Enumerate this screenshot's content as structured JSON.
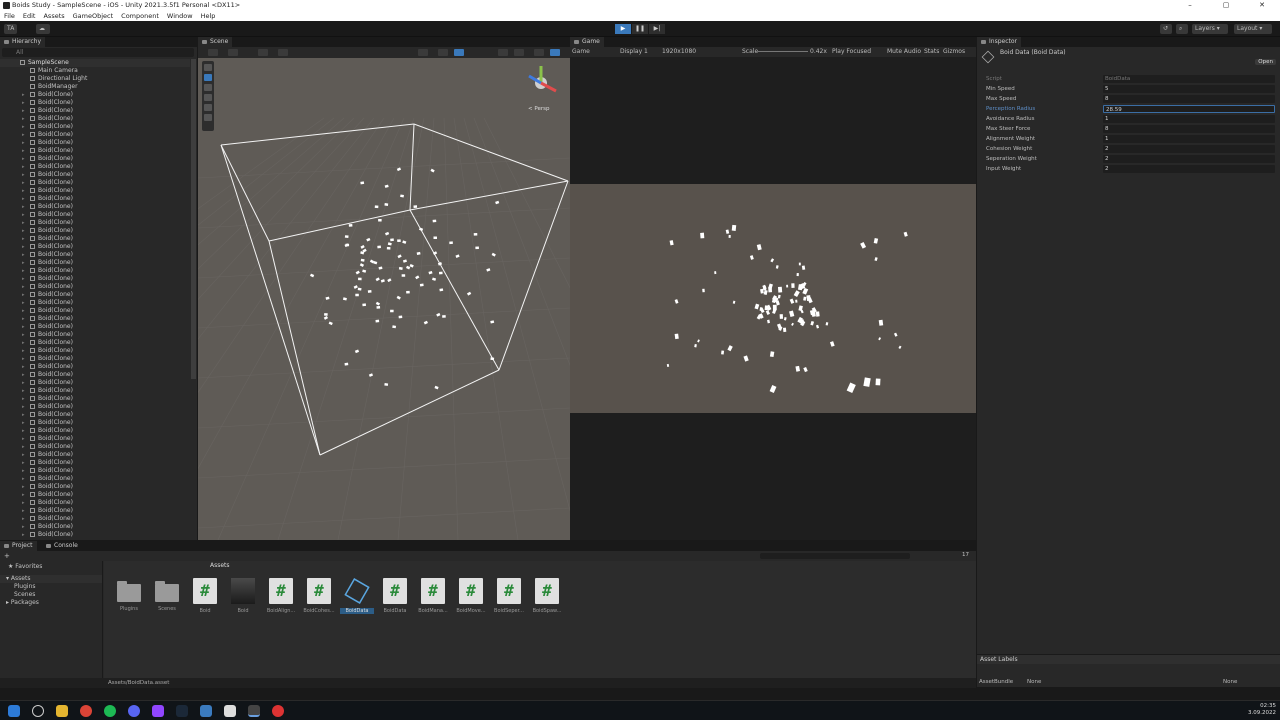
{
  "window": {
    "title": "Boids Study - SampleScene - iOS - Unity 2021.3.5f1 Personal <DX11>",
    "controls": [
      "–",
      "▢",
      "✕"
    ]
  },
  "menu": [
    "File",
    "Edit",
    "Assets",
    "GameObject",
    "Component",
    "Window",
    "Help"
  ],
  "toolbar": {
    "account": "TA",
    "layers": "Layers",
    "layout": "Layout"
  },
  "hierarchy": {
    "tab": "Hierarchy",
    "search_placeholder": "All",
    "scene": "SampleScene",
    "children": [
      "Main Camera",
      "Directional Light",
      "BoidManager"
    ],
    "boid_label": "Boid(Clone)"
  },
  "scene": {
    "tab": "Scene",
    "persp": "< Persp"
  },
  "game": {
    "tab": "Game",
    "mode": "Game",
    "display": "Display 1",
    "resolution": "1920x1080",
    "scale_label": "Scale",
    "scale_value": "0.42x",
    "play_focused": "Play Focused",
    "mute": "Mute Audio",
    "stats": "Stats",
    "gizmos": "Gizmos"
  },
  "inspector": {
    "tab": "Inspector",
    "title": "Boid Data (Boid Data)",
    "open_label": "Open",
    "script_label": "Script",
    "script_value": "BoidData",
    "properties": [
      {
        "label": "Min Speed",
        "value": "5"
      },
      {
        "label": "Max Speed",
        "value": "8"
      },
      {
        "label": "Perception Radius",
        "value": "28.59"
      },
      {
        "label": "Avoidance Radius",
        "value": "1"
      },
      {
        "label": "Max Steer Force",
        "value": "8"
      },
      {
        "label": "Alignment Weight",
        "value": "1"
      },
      {
        "label": "Cohesion Weight",
        "value": "2"
      },
      {
        "label": "Seperation Weight",
        "value": "2"
      },
      {
        "label": "Input Weight",
        "value": "2"
      }
    ],
    "asset_labels": "Asset Labels",
    "asset_bundle": "AssetBundle",
    "bundle_value": "None",
    "variant_value": "None"
  },
  "project": {
    "tab_project": "Project",
    "tab_console": "Console",
    "path": "Assets",
    "favorites": "Favorites",
    "tree": [
      "Assets",
      "Plugins",
      "Scenes",
      "Packages"
    ],
    "count": "17",
    "assets": [
      {
        "name": "Plugins",
        "kind": "folder"
      },
      {
        "name": "Scenes",
        "kind": "folder"
      },
      {
        "name": "Boid",
        "kind": "script"
      },
      {
        "name": "Boid",
        "kind": "mesh"
      },
      {
        "name": "BoidAlign...",
        "kind": "script"
      },
      {
        "name": "BoidCohes...",
        "kind": "script"
      },
      {
        "name": "BoidData",
        "kind": "scriptable"
      },
      {
        "name": "BoidData",
        "kind": "script"
      },
      {
        "name": "BoidMana...",
        "kind": "script"
      },
      {
        "name": "BoidMove...",
        "kind": "script"
      },
      {
        "name": "BoidSeper...",
        "kind": "script"
      },
      {
        "name": "BoidSpaw...",
        "kind": "script"
      }
    ],
    "status_path": "Assets/BoidData.asset"
  },
  "taskbar": {
    "time": "02:35",
    "date": "3.09.2022"
  },
  "colors": {
    "accent": "#3a79bb",
    "script_hash": "#2a8a3a",
    "highlight_label": "#5e8fc9"
  }
}
